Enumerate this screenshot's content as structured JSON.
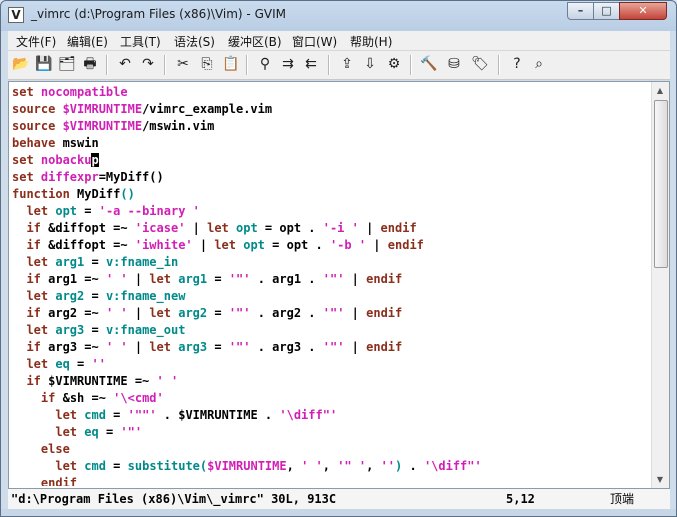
{
  "window": {
    "title": "_vimrc (d:\\Program Files (x86)\\Vim) - GVIM",
    "controls": {
      "minimize": "–",
      "maximize": "□",
      "close": "✕"
    }
  },
  "menubar": {
    "items": [
      "文件(F)",
      "编辑(E)",
      "工具(T)",
      "语法(S)",
      "缓冲区(B)",
      "窗口(W)",
      "帮助(H)"
    ]
  },
  "toolbar": {
    "buttons": [
      {
        "name": "open-icon",
        "glyph": "📂"
      },
      {
        "name": "save-icon",
        "glyph": "💾"
      },
      {
        "name": "save-all-icon",
        "glyph": "🗂"
      },
      {
        "name": "print-icon",
        "glyph": "🖶"
      },
      {
        "name": "undo-icon",
        "glyph": "↶"
      },
      {
        "name": "redo-icon",
        "glyph": "↷"
      },
      {
        "name": "cut-icon",
        "glyph": "✂"
      },
      {
        "name": "copy-icon",
        "glyph": "⎘"
      },
      {
        "name": "paste-icon",
        "glyph": "📋"
      },
      {
        "name": "find-replace-icon",
        "glyph": "⚲"
      },
      {
        "name": "find-next-icon",
        "glyph": "⇉"
      },
      {
        "name": "find-prev-icon",
        "glyph": "⇇"
      },
      {
        "name": "load-session-icon",
        "glyph": "⇪"
      },
      {
        "name": "save-session-icon",
        "glyph": "⇩"
      },
      {
        "name": "run-script-icon",
        "glyph": "⚙"
      },
      {
        "name": "make-icon",
        "glyph": "🔨"
      },
      {
        "name": "shell-icon",
        "glyph": "⛁"
      },
      {
        "name": "tag-icon",
        "glyph": "🏷"
      },
      {
        "name": "help-icon",
        "glyph": "?"
      },
      {
        "name": "find-help-icon",
        "glyph": "⌕"
      }
    ]
  },
  "editor": {
    "lines": [
      [
        [
          "kw",
          "set "
        ],
        [
          "st",
          "nocompatible"
        ]
      ],
      [
        [
          "kw",
          "source "
        ],
        [
          "st",
          "$VIMRUNTIME"
        ],
        [
          "n",
          "/vimrc_example.vim"
        ]
      ],
      [
        [
          "kw",
          "source "
        ],
        [
          "st",
          "$VIMRUNTIME"
        ],
        [
          "n",
          "/mswin.vim"
        ]
      ],
      [
        [
          "kw",
          "behave "
        ],
        [
          "n",
          "mswin"
        ]
      ],
      [
        [
          "kw",
          "set "
        ],
        [
          "st",
          "nobacku"
        ],
        [
          "cursor",
          "p"
        ]
      ],
      [
        [
          "kw",
          "set "
        ],
        [
          "st",
          "diffexpr"
        ],
        [
          "n",
          "=MyDiff()"
        ]
      ],
      [
        [
          "kw",
          "function "
        ],
        [
          "n",
          "MyDiff"
        ],
        [
          "vr",
          "()"
        ]
      ],
      [
        [
          "n",
          "  "
        ],
        [
          "kw",
          "let "
        ],
        [
          "vr",
          "opt"
        ],
        [
          "n",
          " = "
        ],
        [
          "st",
          "'-a --binary '"
        ]
      ],
      [
        [
          "n",
          "  "
        ],
        [
          "kw",
          "if "
        ],
        [
          "n",
          "&diffopt =~ "
        ],
        [
          "st",
          "'icase'"
        ],
        [
          "n",
          " | "
        ],
        [
          "kw",
          "let "
        ],
        [
          "vr",
          "opt"
        ],
        [
          "n",
          " = opt . "
        ],
        [
          "st",
          "'-i '"
        ],
        [
          "n",
          " | "
        ],
        [
          "kw",
          "endif"
        ]
      ],
      [
        [
          "n",
          "  "
        ],
        [
          "kw",
          "if "
        ],
        [
          "n",
          "&diffopt =~ "
        ],
        [
          "st",
          "'iwhite'"
        ],
        [
          "n",
          " | "
        ],
        [
          "kw",
          "let "
        ],
        [
          "vr",
          "opt"
        ],
        [
          "n",
          " = opt . "
        ],
        [
          "st",
          "'-b '"
        ],
        [
          "n",
          " | "
        ],
        [
          "kw",
          "endif"
        ]
      ],
      [
        [
          "n",
          "  "
        ],
        [
          "kw",
          "let "
        ],
        [
          "vr",
          "arg1"
        ],
        [
          "n",
          " = "
        ],
        [
          "vr",
          "v:fname_in"
        ]
      ],
      [
        [
          "n",
          "  "
        ],
        [
          "kw",
          "if "
        ],
        [
          "n",
          "arg1 =~ "
        ],
        [
          "st",
          "' '"
        ],
        [
          "n",
          " | "
        ],
        [
          "kw",
          "let "
        ],
        [
          "vr",
          "arg1"
        ],
        [
          "n",
          " = "
        ],
        [
          "st",
          "'\"'"
        ],
        [
          "n",
          " . arg1 . "
        ],
        [
          "st",
          "'\"'"
        ],
        [
          "n",
          " | "
        ],
        [
          "kw",
          "endif"
        ]
      ],
      [
        [
          "n",
          "  "
        ],
        [
          "kw",
          "let "
        ],
        [
          "vr",
          "arg2"
        ],
        [
          "n",
          " = "
        ],
        [
          "vr",
          "v:fname_new"
        ]
      ],
      [
        [
          "n",
          "  "
        ],
        [
          "kw",
          "if "
        ],
        [
          "n",
          "arg2 =~ "
        ],
        [
          "st",
          "' '"
        ],
        [
          "n",
          " | "
        ],
        [
          "kw",
          "let "
        ],
        [
          "vr",
          "arg2"
        ],
        [
          "n",
          " = "
        ],
        [
          "st",
          "'\"'"
        ],
        [
          "n",
          " . arg2 . "
        ],
        [
          "st",
          "'\"'"
        ],
        [
          "n",
          " | "
        ],
        [
          "kw",
          "endif"
        ]
      ],
      [
        [
          "n",
          "  "
        ],
        [
          "kw",
          "let "
        ],
        [
          "vr",
          "arg3"
        ],
        [
          "n",
          " = "
        ],
        [
          "vr",
          "v:fname_out"
        ]
      ],
      [
        [
          "n",
          "  "
        ],
        [
          "kw",
          "if "
        ],
        [
          "n",
          "arg3 =~ "
        ],
        [
          "st",
          "' '"
        ],
        [
          "n",
          " | "
        ],
        [
          "kw",
          "let "
        ],
        [
          "vr",
          "arg3"
        ],
        [
          "n",
          " = "
        ],
        [
          "st",
          "'\"'"
        ],
        [
          "n",
          " . arg3 . "
        ],
        [
          "st",
          "'\"'"
        ],
        [
          "n",
          " | "
        ],
        [
          "kw",
          "endif"
        ]
      ],
      [
        [
          "n",
          "  "
        ],
        [
          "kw",
          "let "
        ],
        [
          "vr",
          "eq"
        ],
        [
          "n",
          " = "
        ],
        [
          "st",
          "''"
        ]
      ],
      [
        [
          "n",
          "  "
        ],
        [
          "kw",
          "if "
        ],
        [
          "n",
          "$VIMRUNTIME =~ "
        ],
        [
          "st",
          "' '"
        ]
      ],
      [
        [
          "n",
          "    "
        ],
        [
          "kw",
          "if "
        ],
        [
          "n",
          "&sh =~ "
        ],
        [
          "st",
          "'\\<cmd'"
        ]
      ],
      [
        [
          "n",
          "      "
        ],
        [
          "kw",
          "let "
        ],
        [
          "vr",
          "cmd"
        ],
        [
          "n",
          " = "
        ],
        [
          "st",
          "'\"\"'"
        ],
        [
          "n",
          " . $VIMRUNTIME . "
        ],
        [
          "st",
          "'\\diff\"'"
        ]
      ],
      [
        [
          "n",
          "      "
        ],
        [
          "kw",
          "let "
        ],
        [
          "vr",
          "eq"
        ],
        [
          "n",
          " = "
        ],
        [
          "st",
          "'\"'"
        ]
      ],
      [
        [
          "n",
          "    "
        ],
        [
          "kw",
          "else"
        ]
      ],
      [
        [
          "n",
          "      "
        ],
        [
          "kw",
          "let "
        ],
        [
          "vr",
          "cmd"
        ],
        [
          "n",
          " = "
        ],
        [
          "vr",
          "substitute("
        ],
        [
          "st",
          "$VIMRUNTIME"
        ],
        [
          "n",
          ", "
        ],
        [
          "st",
          "' '"
        ],
        [
          "n",
          ", "
        ],
        [
          "st",
          "'\" '"
        ],
        [
          "n",
          ", "
        ],
        [
          "st",
          "''"
        ],
        [
          "vr",
          ")"
        ],
        [
          "n",
          " . "
        ],
        [
          "st",
          "'\\diff\"'"
        ]
      ],
      [
        [
          "n",
          "    "
        ],
        [
          "kw",
          "endif"
        ]
      ]
    ]
  },
  "statusline": {
    "file": "\"d:\\Program Files (x86)\\Vim\\_vimrc\" 30L, 913C",
    "position": "5,12",
    "percent": "顶端"
  }
}
